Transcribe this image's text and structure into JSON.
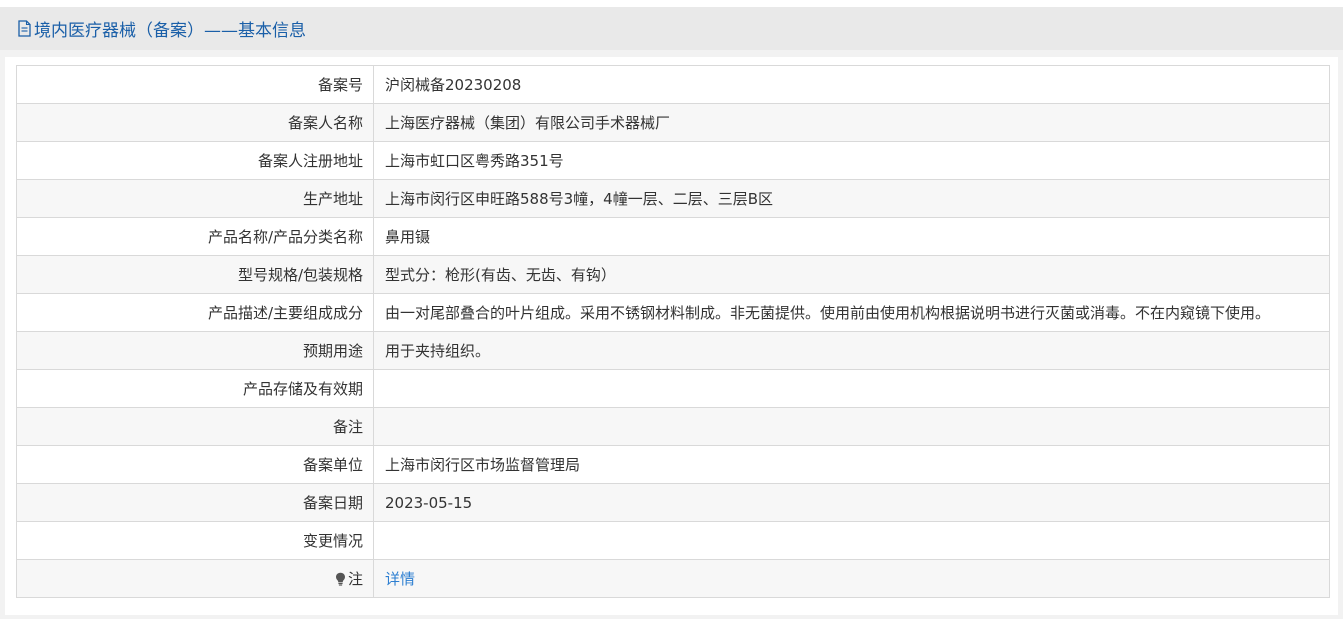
{
  "header": {
    "title": "境内医疗器械（备案）——基本信息",
    "icon": "document-icon",
    "color": "#1a5fa8"
  },
  "rows": [
    {
      "label": "备案号",
      "value": "沪闵械备20230208"
    },
    {
      "label": "备案人名称",
      "value": "上海医疗器械（集团）有限公司手术器械厂"
    },
    {
      "label": "备案人注册地址",
      "value": "上海市虹口区粤秀路351号"
    },
    {
      "label": "生产地址",
      "value": "上海市闵行区申旺路588号3幢，4幢一层、二层、三层B区"
    },
    {
      "label": "产品名称/产品分类名称",
      "value": "鼻用镊"
    },
    {
      "label": "型号规格/包装规格",
      "value": "型式分：枪形(有齿、无齿、有钩）"
    },
    {
      "label": "产品描述/主要组成成分",
      "value": "由一对尾部叠合的叶片组成。采用不锈钢材料制成。非无菌提供。使用前由使用机构根据说明书进行灭菌或消毒。不在内窥镜下使用。"
    },
    {
      "label": "预期用途",
      "value": "用于夹持组织。"
    },
    {
      "label": "产品存储及有效期",
      "value": ""
    },
    {
      "label": "备注",
      "value": ""
    },
    {
      "label": "备案单位",
      "value": "上海市闵行区市场监督管理局"
    },
    {
      "label": "备案日期",
      "value": "2023-05-15"
    },
    {
      "label": "变更情况",
      "value": ""
    }
  ],
  "note": {
    "label": "注",
    "icon": "lightbulb-icon",
    "link": "详情",
    "link_color": "#2d7fd1"
  }
}
